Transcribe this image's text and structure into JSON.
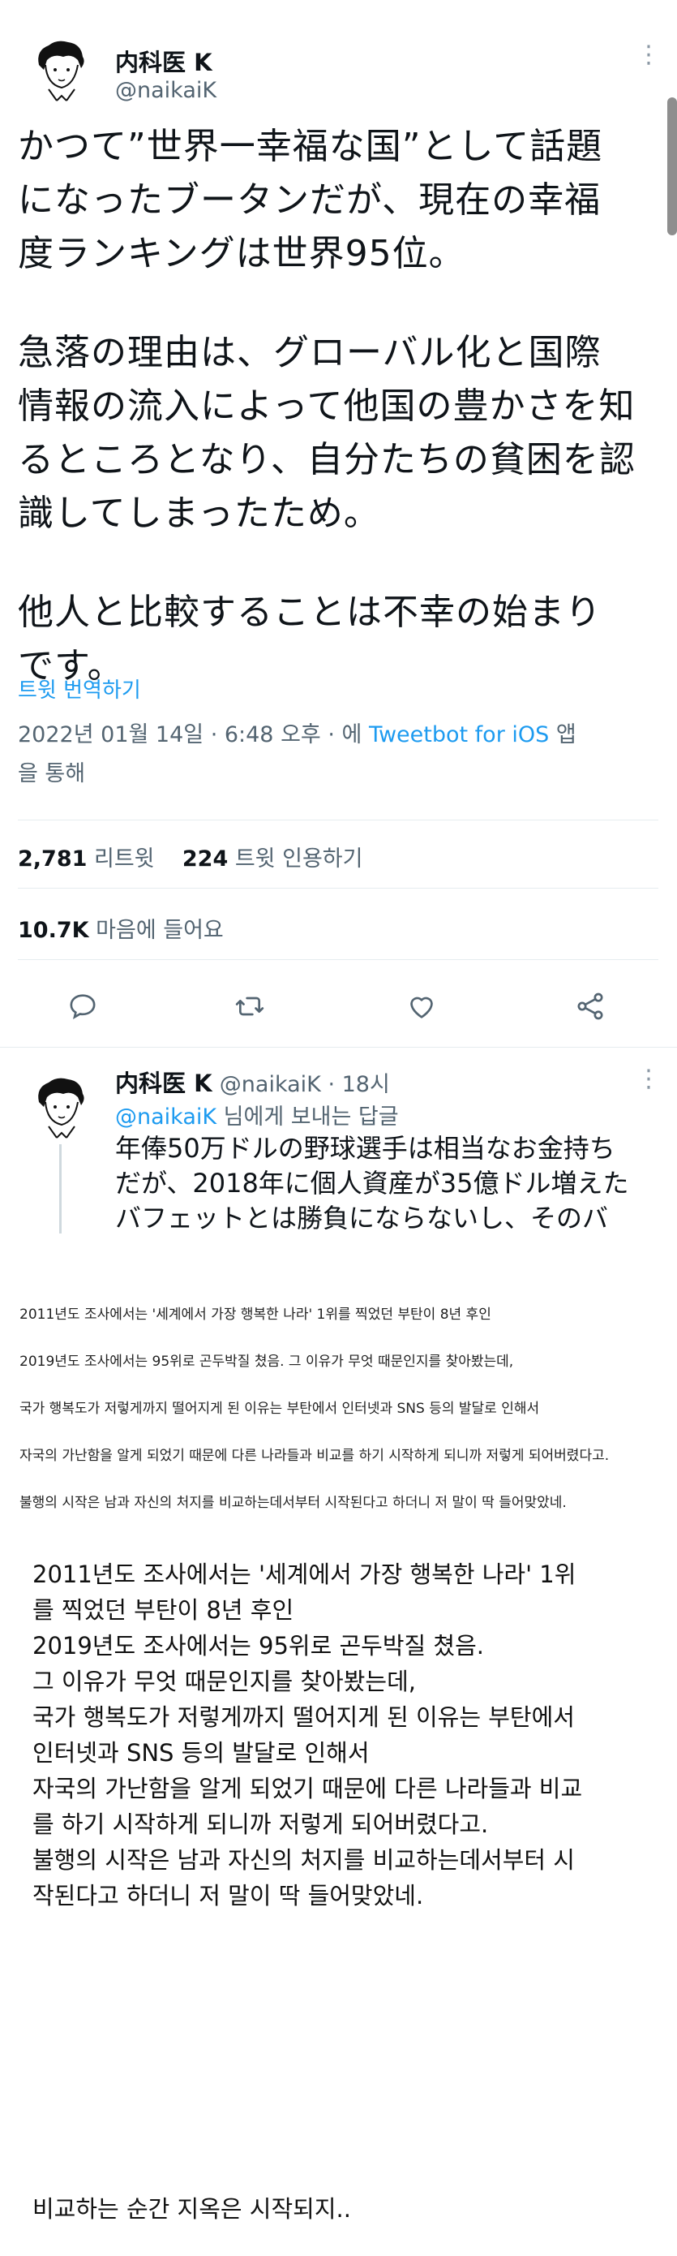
{
  "tweet": {
    "display_name": "内科医 K",
    "handle": "@naikaiK",
    "more_label": "⋮",
    "body_lines": [
      "かつて”世界一幸福な国”として話題",
      "になったブータンだが、現在の幸福",
      "度ランキングは世界95位。",
      "",
      "急落の理由は、グローバル化と国際",
      "情報の流入によって他国の豊かさを知",
      "るところとなり、自分たちの貧困を認",
      "識してしまったため。",
      "",
      "他人と比較することは不幸の始まり",
      "です。"
    ],
    "translate_label": "트윗 번역하기",
    "timestamp": "2022년 01월 14일 · 6:48 오후 · 에",
    "client": "Tweetbot for iOS",
    "client_suffix": "앱",
    "via_line": "을 통해",
    "retweets_count": "2,781",
    "retweets_label": "리트윗",
    "quotes_count": "224",
    "quotes_label": "트윗 인용하기",
    "likes_count": "10.7K",
    "likes_label": "마음에 들어요",
    "actions": [
      "reply-icon",
      "retweet-icon",
      "heart-icon",
      "share-icon"
    ]
  },
  "reply": {
    "display_name": "内科医 K",
    "handle_time": "@naikaiK · 18시",
    "more_label": "⋮",
    "mention": "@naikaiK",
    "reply_to_suffix": "님에게 보내는 답글",
    "text_lines": [
      "年俸50万ドルの野球選手は相当なお金持ち",
      "だが、2018年に個人資産が35億ドル増えた",
      "バフェットとは勝負にならないし、そのバ"
    ]
  },
  "small_caption": [
    "2011년도 조사에서는 '세계에서 가장 행복한 나라' 1위를 찍었던 부탄이 8년 후인",
    "2019년도 조사에서는 95위로 곤두박질 쳤음. 그 이유가 무엇 때문인지를 찾아봤는데,",
    "국가 행복도가 저렇게까지 떨어지게 된 이유는 부탄에서 인터넷과 SNS 등의 발달로 인해서",
    "자국의 가난함을 알게 되었기 때문에 다른 나라들과 비교를 하기 시작하게 되니까 저렇게 되어버렸다고.",
    "불행의 시작은 남과 자신의 처지를 비교하는데서부터 시작된다고 하더니 저 말이 딱 들어맞았네."
  ],
  "big_caption": [
    "2011년도 조사에서는 '세계에서 가장 행복한 나라' 1위",
    "를 찍었던 부탄이 8년 후인",
    "2019년도 조사에서는 95위로 곤두박질 쳤음.",
    "그 이유가 무엇 때문인지를 찾아봤는데,",
    "국가 행복도가 저렇게까지 떨어지게 된 이유는 부탄에서",
    "인터넷과 SNS 등의 발달로 인해서",
    "자국의 가난함을 알게 되었기 때문에 다른 나라들과 비교",
    "를 하기 시작하게 되니까 저렇게 되어버렸다고.",
    "불행의 시작은 남과 자신의 처지를 비교하는데서부터 시",
    "작된다고 하더니 저 말이 딱 들어맞았네."
  ],
  "closing_line": "비교하는 순간 지옥은 시작되지..",
  "colors": {
    "link_blue": "#1d9bf0",
    "muted_gray": "#536471",
    "text_dark": "#0f1419"
  }
}
